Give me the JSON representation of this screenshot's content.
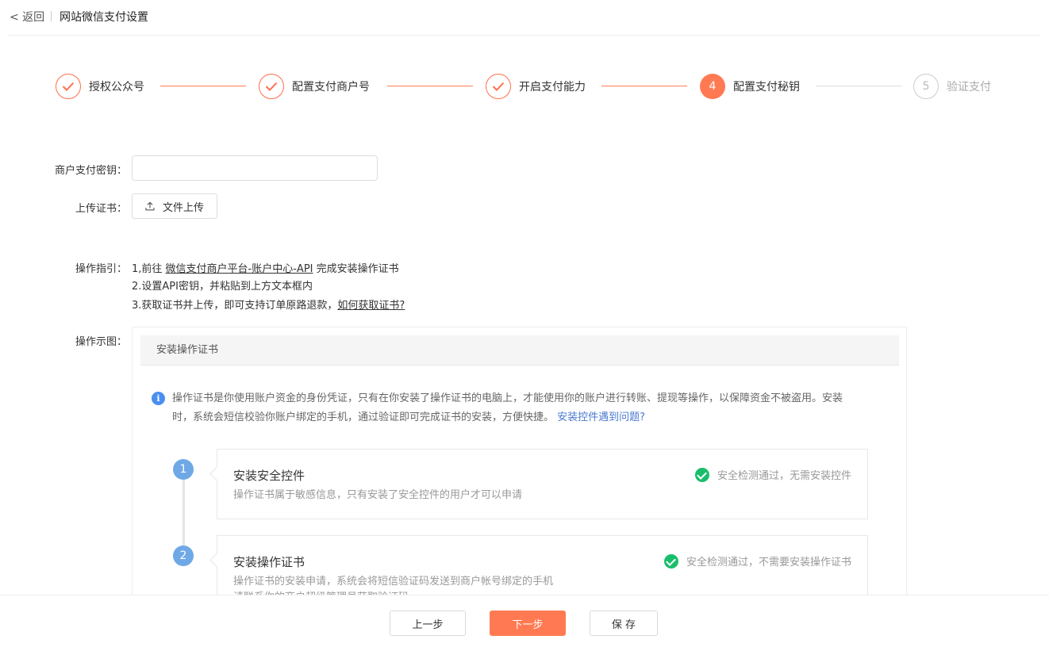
{
  "header": {
    "back_label": "< 返回",
    "title": "网站微信支付设置"
  },
  "steps": [
    {
      "label": "授权公众号",
      "status": "done"
    },
    {
      "label": "配置支付商户号",
      "status": "done"
    },
    {
      "label": "开启支付能力",
      "status": "done"
    },
    {
      "label": "配置支付秘钥",
      "status": "active",
      "number": "4"
    },
    {
      "label": "验证支付",
      "status": "todo",
      "number": "5"
    }
  ],
  "form": {
    "key_label": "商户支付密钥：",
    "key_value": "",
    "upload_label": "上传证书：",
    "upload_button": "文件上传"
  },
  "guide": {
    "label": "操作指引：",
    "line1_prefix": "1,前往 ",
    "line1_link": "微信支付商户平台-账户中心-API",
    "line1_suffix": " 完成安装操作证书",
    "line2": "2.设置API密钥，并粘贴到上方文本框内",
    "line3_prefix": "3.获取证书并上传，即可支持订单原路退款，",
    "line3_link": "如何获取证书?"
  },
  "demo": {
    "label": "操作示图：",
    "panel_title": "安装操作证书",
    "info_text": "操作证书是你使用账户资金的身份凭证，只有在你安装了操作证书的电脑上，才能使用你的账户进行转账、提现等操作，以保障资金不被盗用。安装时，系统会短信校验你账户绑定的手机，通过验证即可完成证书的安装，方便快捷。",
    "info_link": "安装控件遇到问题?",
    "cards": [
      {
        "number": "1",
        "title": "安装安全控件",
        "desc": "操作证书属于敏感信息，只有安装了安全控件的用户才可以申请",
        "status": "安全检测通过，无需安装控件"
      },
      {
        "number": "2",
        "title": "安装操作证书",
        "desc": "操作证书的安装申请，系统会将短信验证码发送到商户帐号绑定的手机",
        "desc2": "请联系你的商户超级管理员获取验证码",
        "status": "安全检测通过，不需要安装操作证书"
      }
    ]
  },
  "footer": {
    "prev_label": "上一步",
    "next_label": "下一步",
    "save_label": "保 存"
  },
  "colors": {
    "accent": "#ff7a52",
    "success": "#19be6b",
    "info": "#4a8ef0"
  }
}
